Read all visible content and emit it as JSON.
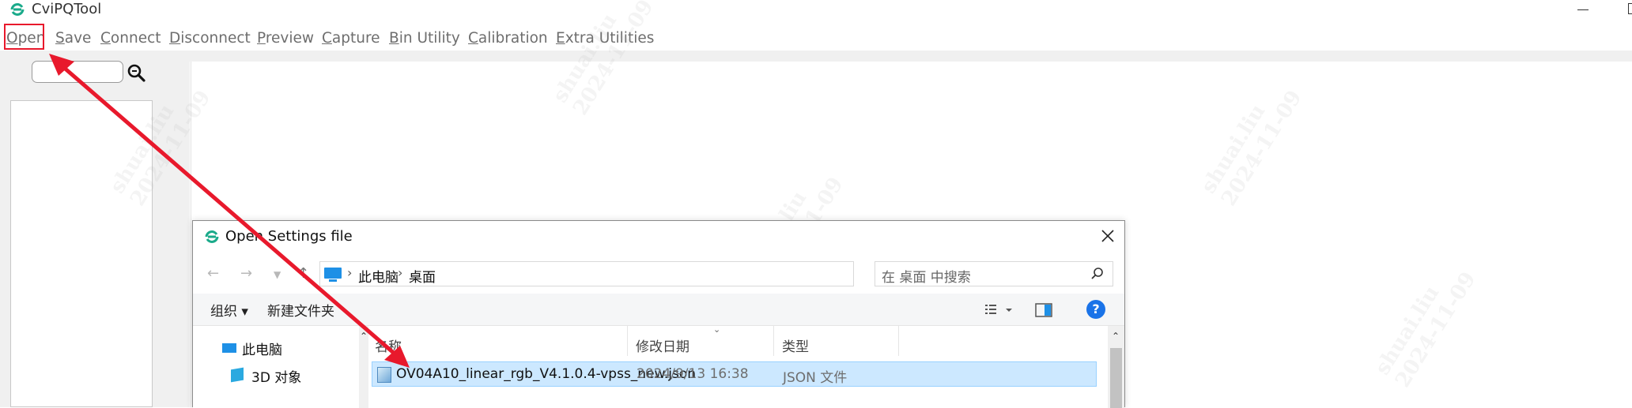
{
  "app": {
    "title": "CviPQTool",
    "brand_color": "#1aaa8a"
  },
  "menu": [
    {
      "key": "O",
      "rest": "pen"
    },
    {
      "key": "S",
      "rest": "ave"
    },
    {
      "key": "C",
      "rest": "onnect"
    },
    {
      "key": "D",
      "rest": "isconnect"
    },
    {
      "key": "P",
      "rest": "review"
    },
    {
      "key": "C",
      "rest": "apture"
    },
    {
      "key": "B",
      "rest": "in Utility"
    },
    {
      "key": "C",
      "rest": "alibration"
    },
    {
      "key": "E",
      "rest": "xtra Utilities"
    }
  ],
  "watermark": {
    "name": "shuai.liu",
    "date": "2024-11-09"
  },
  "annotation": {
    "color": "#e8192c"
  },
  "dialog": {
    "title": "Open Settings file",
    "breadcrumb": [
      "此电脑",
      "桌面"
    ],
    "search_placeholder": "在 桌面 中搜索",
    "organize": "组织",
    "new_folder": "新建文件夹",
    "nav_items": [
      "此电脑",
      "3D 对象"
    ],
    "columns": {
      "name": "名称",
      "date": "修改日期",
      "type": "类型"
    },
    "files": [
      {
        "name": "OV04A10_linear_rgb_V4.1.0.4-vpss_new.json",
        "date": "2024/9/13 16:38",
        "type": "JSON 文件"
      }
    ]
  }
}
